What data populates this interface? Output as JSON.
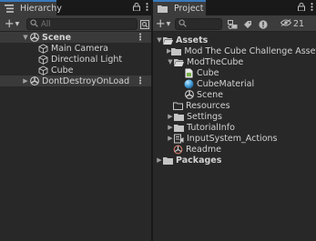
{
  "hierarchy": {
    "tab_label": "Hierarchy",
    "add_label": "+",
    "search_placeholder": "All",
    "scene": "Scene",
    "objects": [
      "Main Camera",
      "Directional Light",
      "Cube"
    ],
    "dont_destroy": "DontDestroyOnLoad",
    "tab_icon": "list-icon"
  },
  "project": {
    "tab_label": "Project",
    "add_label": "+",
    "hidden_count": "21",
    "tab_icon": "folder-icon",
    "tree": {
      "assets": "Assets",
      "mod_challenge": "Mod The Cube Challenge Assets",
      "mod_cube": "ModTheCube",
      "cube_script": "Cube",
      "cube_material": "CubeMaterial",
      "scene": "Scene",
      "resources": "Resources",
      "settings": "Settings",
      "tutorial_info": "TutorialInfo",
      "input_actions": "InputSystem_Actions",
      "readme": "Readme",
      "packages": "Packages"
    }
  },
  "colors": {
    "tab_accent": "#3a79bb",
    "folder": "#c4c4c4",
    "material": "#4aa6e0",
    "script": "#7ab34a"
  }
}
